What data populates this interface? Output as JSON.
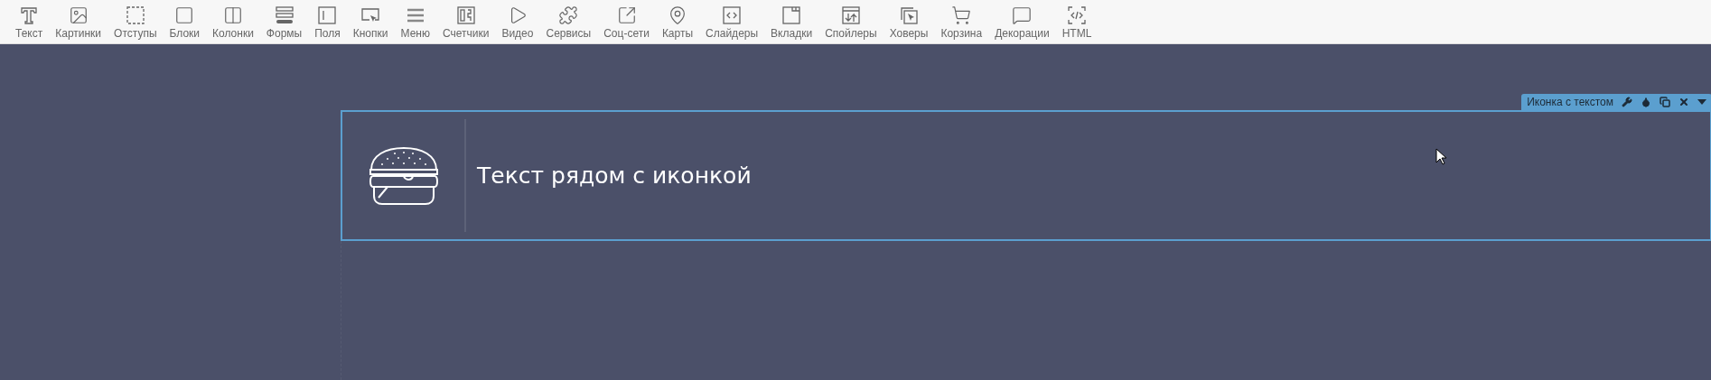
{
  "toolbar": {
    "items": [
      {
        "kind": "text",
        "label": "Текст"
      },
      {
        "kind": "image",
        "label": "Картинки"
      },
      {
        "kind": "dashed",
        "label": "Отступы"
      },
      {
        "kind": "square",
        "label": "Блоки"
      },
      {
        "kind": "columns",
        "label": "Колонки"
      },
      {
        "kind": "form",
        "label": "Формы"
      },
      {
        "kind": "field",
        "label": "Поля"
      },
      {
        "kind": "button",
        "label": "Кнопки"
      },
      {
        "kind": "menu",
        "label": "Меню"
      },
      {
        "kind": "counter",
        "label": "Счетчики"
      },
      {
        "kind": "video",
        "label": "Видео"
      },
      {
        "kind": "puzzle",
        "label": "Сервисы"
      },
      {
        "kind": "share",
        "label": "Соц-сети"
      },
      {
        "kind": "map",
        "label": "Карты"
      },
      {
        "kind": "slider",
        "label": "Слайдеры"
      },
      {
        "kind": "tabs",
        "label": "Вкладки"
      },
      {
        "kind": "spoiler",
        "label": "Спойлеры"
      },
      {
        "kind": "hover",
        "label": "Ховеры"
      },
      {
        "kind": "cart",
        "label": "Корзина"
      },
      {
        "kind": "bubble",
        "label": "Декорации"
      },
      {
        "kind": "html",
        "label": "HTML"
      }
    ]
  },
  "selection": {
    "label": "Иконка с текстом"
  },
  "block": {
    "text": "Текст рядом с иконкой"
  }
}
